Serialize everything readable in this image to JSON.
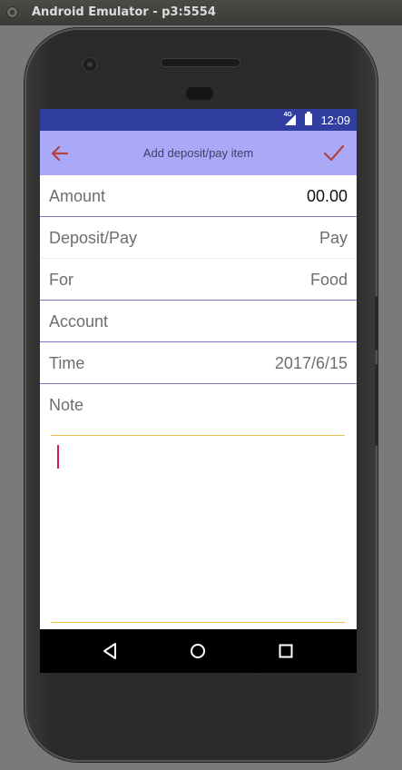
{
  "window": {
    "title": "Android Emulator - p3:5554"
  },
  "status_bar": {
    "network": "4G",
    "time": "12:09"
  },
  "toolbar": {
    "title": "Add deposit/pay item"
  },
  "form": {
    "amount": {
      "label": "Amount",
      "value": "00.00"
    },
    "type": {
      "label": "Deposit/Pay",
      "value": "Pay"
    },
    "category": {
      "label": "For",
      "value": "Food"
    },
    "account": {
      "label": "Account",
      "value": ""
    },
    "time": {
      "label": "Time",
      "value": "2017/6/15"
    },
    "note": {
      "label": "Note",
      "value": ""
    }
  },
  "colors": {
    "status_bar": "#303f9f",
    "toolbar": "#a9a9f8",
    "toolbar_icons": "#b5413b",
    "divider": "#7a7ac8",
    "note_border": "#e6c24a",
    "cursor": "#d81b60"
  },
  "icons": {
    "back": "arrow-left-icon",
    "confirm": "check-icon",
    "nav_back": "triangle-back-icon",
    "nav_home": "circle-home-icon",
    "nav_recents": "square-recents-icon"
  }
}
